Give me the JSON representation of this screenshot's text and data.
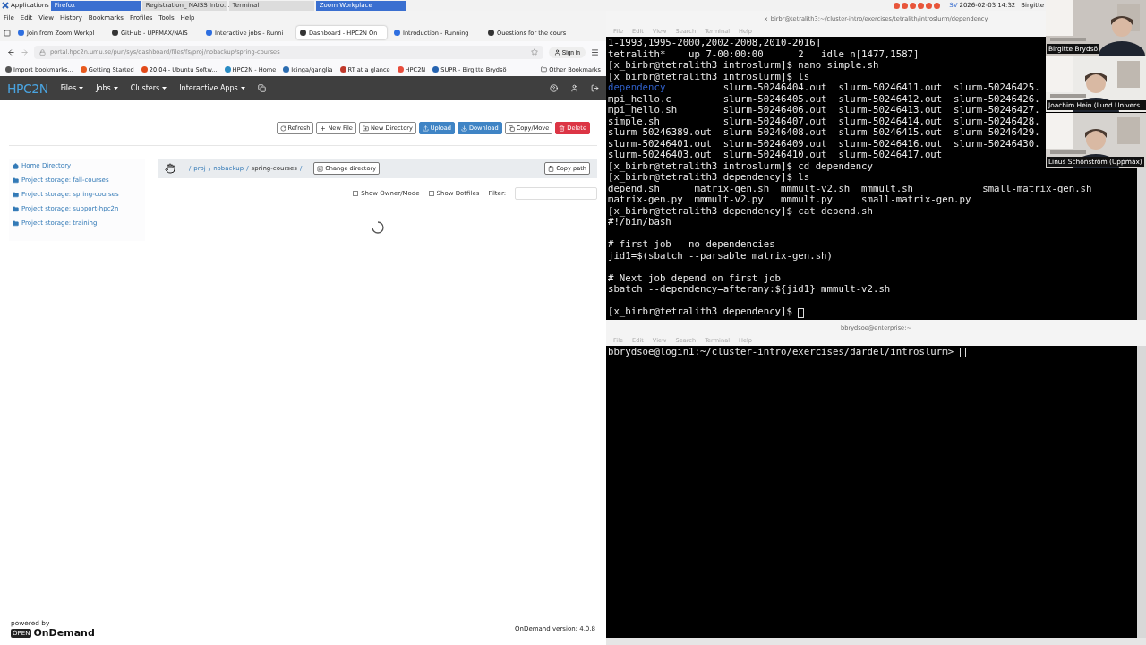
{
  "taskbar": {
    "apps_label": "Applications",
    "tasks": [
      {
        "label": "Firefox",
        "selected": true
      },
      {
        "label": "Registration_ NAISS Intro...",
        "selected": false
      },
      {
        "label": "Terminal",
        "selected": false
      },
      {
        "label": "Zoom Workplace",
        "selected": true
      }
    ],
    "language": "SV",
    "date": "2026-02-03",
    "time": "14:32",
    "user": "Birgitte"
  },
  "browser": {
    "menu": [
      "File",
      "Edit",
      "View",
      "History",
      "Bookmarks",
      "Profiles",
      "Tools",
      "Help"
    ],
    "tabs": [
      {
        "label": "Join from Zoom Workpl",
        "selected": false
      },
      {
        "label": "GitHub - UPPMAX/NAIS",
        "selected": false
      },
      {
        "label": "Interactive jobs - Runni",
        "selected": false
      },
      {
        "label": "Dashboard - HPC2N On",
        "selected": true
      },
      {
        "label": "Introduction - Running",
        "selected": false
      },
      {
        "label": "Questions for the cours",
        "selected": false
      }
    ],
    "url": "portal.hpc2n.umu.se/pun/sys/dashboard/files/fs/proj/nobackup/spring-courses",
    "sign_in": "Sign in",
    "bookmarks": [
      "Import bookmarks...",
      "Getting Started",
      "20.04 - Ubuntu Softw...",
      "HPC2N - Home",
      "Icinga/ganglia",
      "RT at a glance",
      "HPC2N",
      "SUPR - Birgitte Brydsö"
    ],
    "other_bookmarks": "Other Bookmarks"
  },
  "ondemand": {
    "brand": "HPC2N",
    "nav": [
      "Files",
      "Jobs",
      "Clusters",
      "Interactive Apps"
    ],
    "actions": [
      {
        "label": "Refresh",
        "kind": "refresh"
      },
      {
        "label": "New File",
        "kind": "new-file"
      },
      {
        "label": "New Directory",
        "kind": "new-directory"
      },
      {
        "label": "Upload",
        "kind": "upload"
      },
      {
        "label": "Download",
        "kind": "download"
      },
      {
        "label": "Copy/Move",
        "kind": "copy"
      },
      {
        "label": "Delete",
        "kind": "delete"
      }
    ],
    "sidebar": [
      {
        "label": "Home Directory",
        "kind": "home"
      },
      {
        "label": "Project storage: fall-courses",
        "kind": "folder"
      },
      {
        "label": "Project storage: spring-courses",
        "kind": "folder"
      },
      {
        "label": "Project storage: support-hpc2n",
        "kind": "folder"
      },
      {
        "label": "Project storage: training",
        "kind": "folder"
      }
    ],
    "breadcrumb": [
      {
        "text": "/",
        "kind": "sep"
      },
      {
        "text": "proj",
        "kind": "link"
      },
      {
        "text": "/",
        "kind": "sep"
      },
      {
        "text": "nobackup",
        "kind": "link"
      },
      {
        "text": "/",
        "kind": "sep"
      },
      {
        "text": "spring-courses",
        "kind": "current"
      },
      {
        "text": "/",
        "kind": "sep"
      }
    ],
    "change_directory": "Change directory",
    "copy_path": "Copy path",
    "options": [
      {
        "label": "Show Owner/Mode",
        "checked": false
      },
      {
        "label": "Show Dotfiles",
        "checked": false
      }
    ],
    "filter_label": "Filter:",
    "loading": true,
    "powered_by": "powered by",
    "logo_open": "OPEN",
    "logo_name": "OnDemand",
    "version": "OnDemand version: 4.0.8"
  },
  "terminals": [
    {
      "title": "x_birbr@tetralith3:~/cluster-intro/exercises/tetralith/introslurm/dependency",
      "menu": [
        "File",
        "Edit",
        "View",
        "Search",
        "Terminal",
        "Help"
      ],
      "lines": [
        {
          "text": "1-1993,1995-2000,2002-2008,2010-2016]"
        },
        {
          "text": "tetralith*    up 7-00:00:00      2   idle n[1477,1587]"
        },
        {
          "text": "[x_birbr@tetralith3 introslurm]$ nano simple.sh"
        },
        {
          "text": "[x_birbr@tetralith3 introslurm]$ ls"
        },
        {
          "dir": "dependency",
          "text": "          slurm-50246404.out  slurm-50246411.out  slurm-50246425."
        },
        {
          "text": "mpi_hello.c         slurm-50246405.out  slurm-50246412.out  slurm-50246426."
        },
        {
          "text": "mpi_hello.sh        slurm-50246406.out  slurm-50246413.out  slurm-50246427."
        },
        {
          "text": "simple.sh           slurm-50246407.out  slurm-50246414.out  slurm-50246428."
        },
        {
          "text": "slurm-50246389.out  slurm-50246408.out  slurm-50246415.out  slurm-50246429."
        },
        {
          "text": "slurm-50246401.out  slurm-50246409.out  slurm-50246416.out  slurm-50246430."
        },
        {
          "text": "slurm-50246403.out  slurm-50246410.out  slurm-50246417.out"
        },
        {
          "text": "[x_birbr@tetralith3 introslurm]$ cd dependency"
        },
        {
          "text": "[x_birbr@tetralith3 dependency]$ ls"
        },
        {
          "text": "depend.sh      matrix-gen.sh  mmmult-v2.sh  mmmult.sh            small-matrix-gen.sh"
        },
        {
          "text": "matrix-gen.py  mmmult-v2.py   mmmult.py     small-matrix-gen.py"
        },
        {
          "text": "[x_birbr@tetralith3 dependency]$ cat depend.sh"
        },
        {
          "text": "#!/bin/bash"
        },
        {
          "text": "# first job - no dependencies",
          "blank_before": true
        },
        {
          "text": "jid1=$(sbatch --parsable matrix-gen.sh)"
        },
        {
          "text": "# Next job depend on first job",
          "blank_before": true
        },
        {
          "text": "sbatch --dependency=afterany:${jid1} mmmult-v2.sh"
        },
        {
          "text": "[x_birbr@tetralith3 dependency]$ ",
          "cursor": true,
          "blank_before": true
        }
      ]
    },
    {
      "title": "bbrydsoe@enterprise:~",
      "menu": [
        "File",
        "Edit",
        "View",
        "Search",
        "Terminal",
        "Help"
      ],
      "lines": [
        {
          "text": "bbrydsoe@login1:~/cluster-intro/exercises/dardel/introslurm> ",
          "cursor": true
        }
      ]
    }
  ],
  "video_tiles": [
    {
      "name": "Birgitte Brydsö"
    },
    {
      "name": "Joachim Hein (Lund Univers..."
    },
    {
      "name": "Linus Schönström (Uppmax)"
    }
  ]
}
